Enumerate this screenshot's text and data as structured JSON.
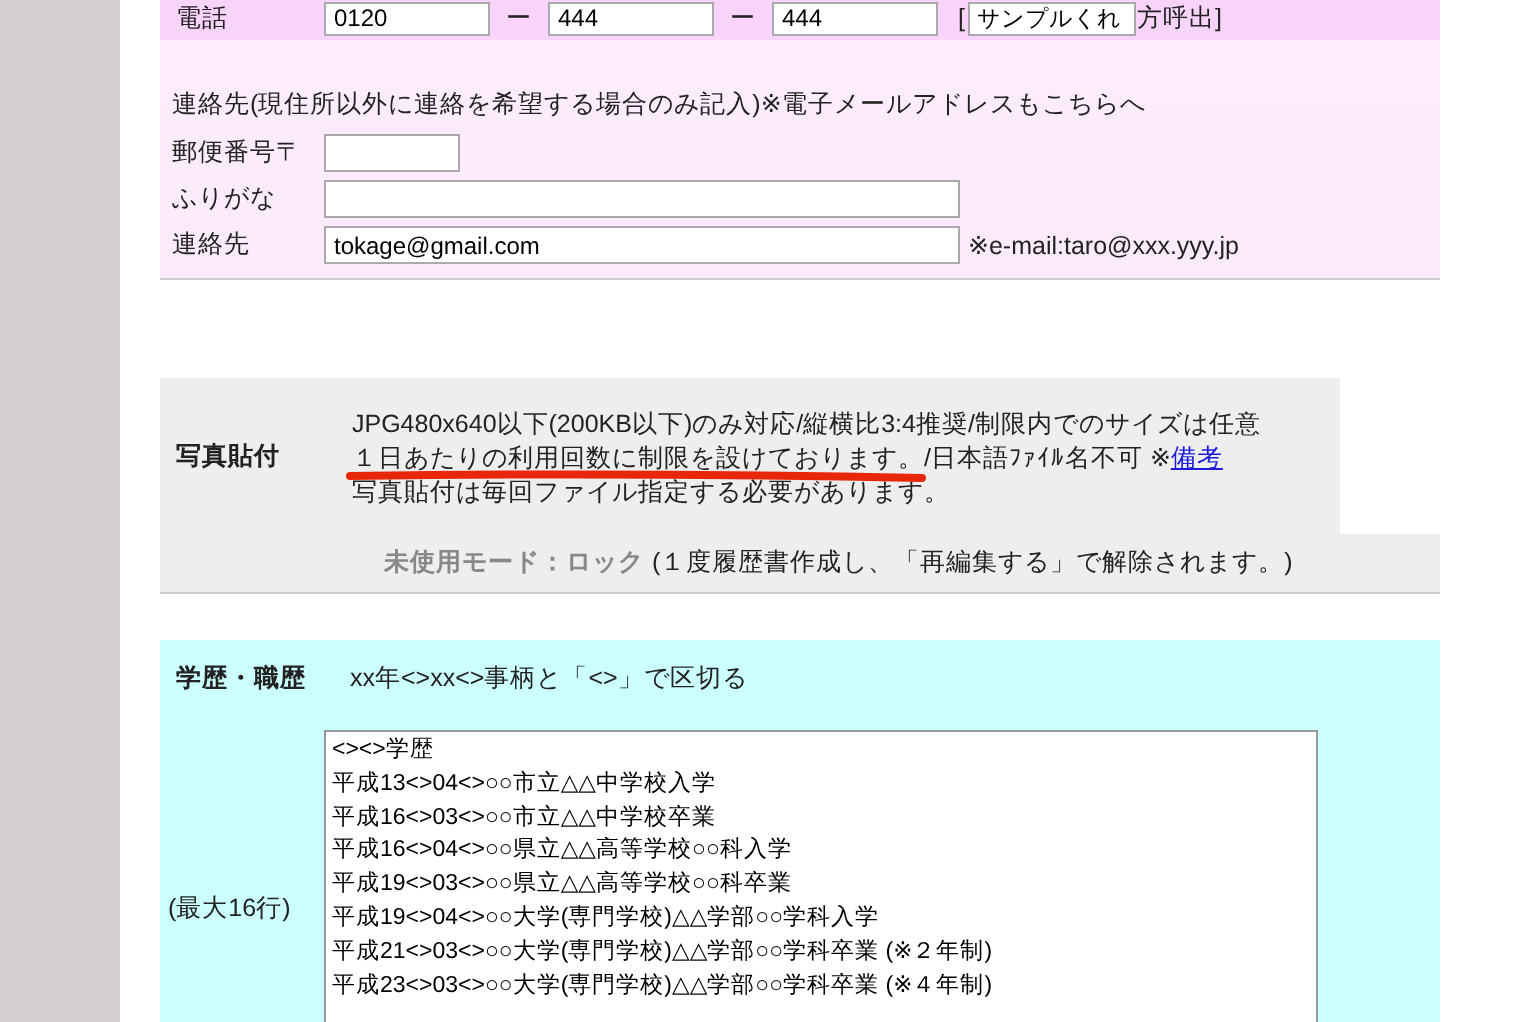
{
  "phone": {
    "label": "電話",
    "fields": [
      "0120",
      "444",
      "444"
    ],
    "separators": [
      "ー",
      "ー"
    ],
    "bracket_open": "[",
    "sample_field": "サンプルくれ",
    "suffix": "方呼出]"
  },
  "contact": {
    "heading": "連絡先(現住所以外に連絡を希望する場合のみ記入)※電子メールアドレスもこちらへ",
    "rows": [
      {
        "label": "郵便番号〒",
        "value": "",
        "kind": "short"
      },
      {
        "label": "ふりがな",
        "value": "",
        "kind": "long"
      },
      {
        "label": "連絡先",
        "value": "tokage@gmail.com",
        "kind": "long",
        "note": "※e-mail:taro@xxx.yyy.jp"
      }
    ]
  },
  "photo": {
    "label": "写真貼付",
    "line_1": "JPG480x640以下(200KB以下)のみ対応/縦横比3:4推奨/制限内でのサイズは任意",
    "line_2_marked": "１日あたりの利用回数に制限を設けております。",
    "line_2_rest": "/日本語ﾌｧｲﾙ名不可 ※",
    "link": "備考",
    "line_3": "写真貼付は毎回ファイル指定する必要があります。",
    "mode_label": "未使用モード：ロック",
    "mode_note": "(１度履歴書作成し、「再編集する」で解除されます。)"
  },
  "history": {
    "label": "学歴・職歴",
    "hint": "xx年<>xx<>事柄と「<>」で区切る",
    "rows_label": "(最大16行)",
    "lines": [
      "<><>学歴",
      "平成13<>04<>○○市立△△中学校入学",
      "平成16<>03<>○○市立△△中学校卒業",
      "平成16<>04<>○○県立△△高等学校○○科入学",
      "平成19<>03<>○○県立△△高等学校○○科卒業",
      "平成19<>04<>○○大学(専門学校)△△学部○○学科入学",
      "平成21<>03<>○○大学(専門学校)△△学部○○学科卒業 (※２年制)",
      "平成23<>03<>○○大学(専門学校)△△学部○○学科卒業 (※４年制)"
    ]
  }
}
